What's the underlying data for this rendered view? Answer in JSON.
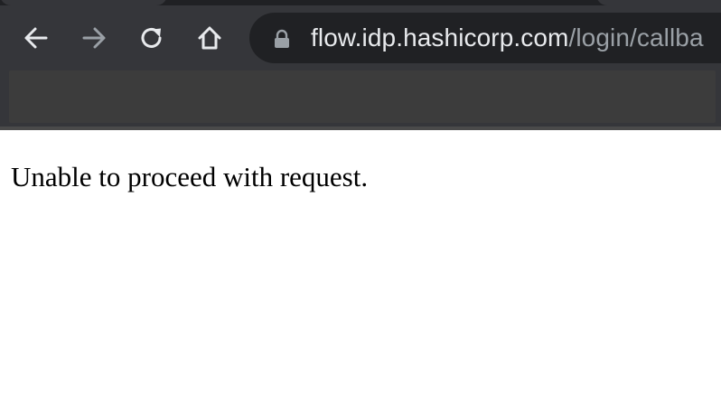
{
  "browser": {
    "nav": {
      "back_icon": "arrow-left-icon",
      "forward_icon": "arrow-right-icon",
      "reload_icon": "reload-icon",
      "home_icon": "home-icon"
    },
    "omnibox": {
      "lock_icon": "lock-icon",
      "host": "flow.idp.hashicorp.com",
      "path": "/login/callba"
    },
    "colors": {
      "toolbar": "#35363a",
      "omnibox": "#202124",
      "bookmarks_bar": "#3c3c3c",
      "icon": "#e8eaed",
      "icon_disabled": "#9aa0a6"
    }
  },
  "page": {
    "message": "Unable to proceed with request."
  }
}
